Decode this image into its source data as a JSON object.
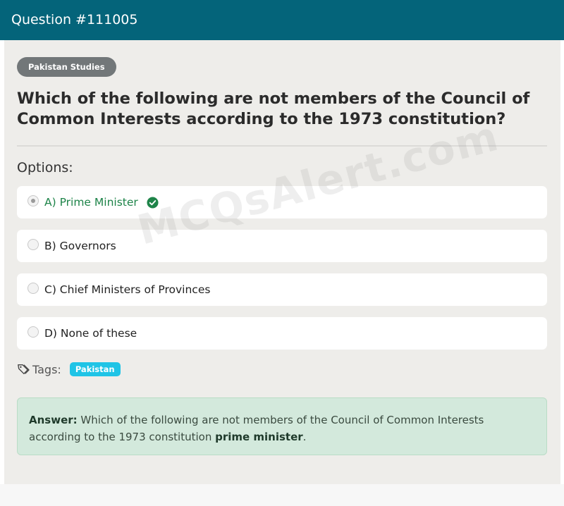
{
  "header": {
    "title": "Question #111005"
  },
  "subject_badge": "Pakistan Studies",
  "question": "Which of the following are not members of the Council of Common Interests according to the 1973 constitution?",
  "options_label": "Options:",
  "options": [
    {
      "label": "A) Prime Minister",
      "selected": true,
      "correct": true
    },
    {
      "label": "B) Governors",
      "selected": false,
      "correct": false
    },
    {
      "label": "C) Chief Ministers of Provinces",
      "selected": false,
      "correct": false
    },
    {
      "label": "D) None of these",
      "selected": false,
      "correct": false
    }
  ],
  "tags": {
    "label": "Tags:",
    "items": [
      "Pakistan"
    ]
  },
  "answer": {
    "prefix": "Answer:",
    "text": " Which of the following are not members of the Council of Common Interests according to the 1973 constitution ",
    "highlight": "prime minister",
    "suffix": "."
  },
  "watermark": "MCQsAlert.com",
  "colors": {
    "header_bg": "#04647a",
    "correct_text": "#1e8449",
    "tag_badge": "#1fc4e6",
    "answer_bg": "#d3e9dc"
  }
}
